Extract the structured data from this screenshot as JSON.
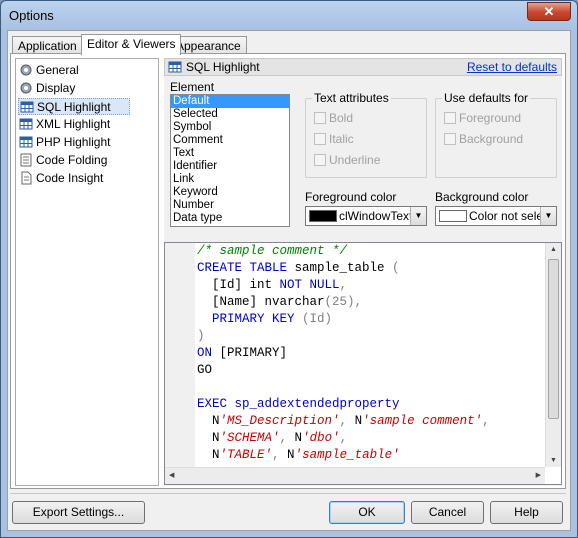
{
  "window": {
    "title": "Options",
    "close_glyph": "✕"
  },
  "tabs": [
    {
      "label": "Application",
      "active": false
    },
    {
      "label": "Editor & Viewers",
      "active": true
    },
    {
      "label": "Appearance",
      "active": false
    }
  ],
  "sidebar": {
    "items": [
      {
        "label": "General",
        "icon": "gear-icon"
      },
      {
        "label": "Display",
        "icon": "display-icon"
      },
      {
        "label": "SQL Highlight",
        "icon": "grid-icon",
        "selected": true
      },
      {
        "label": "XML Highlight",
        "icon": "grid-icon"
      },
      {
        "label": "PHP Highlight",
        "icon": "grid-icon"
      },
      {
        "label": "Code Folding",
        "icon": "folding-icon"
      },
      {
        "label": "Code Insight",
        "icon": "document-icon"
      }
    ]
  },
  "header": {
    "title": "SQL Highlight",
    "reset_label": "Reset to defaults"
  },
  "element": {
    "label": "Element",
    "items": [
      "Default",
      "Selected",
      "Symbol",
      "Comment",
      "Text",
      "Identifier",
      "Link",
      "Keyword",
      "Number",
      "Data type"
    ],
    "selected_index": 0
  },
  "text_attributes": {
    "title": "Text attributes",
    "bold": "Bold",
    "italic": "Italic",
    "underline": "Underline"
  },
  "use_defaults": {
    "title": "Use defaults for",
    "foreground": "Foreground",
    "background": "Background"
  },
  "foreground": {
    "label": "Foreground color",
    "value": "clWindowText",
    "swatch": "#000000"
  },
  "background": {
    "label": "Background color",
    "value": "Color not selected",
    "swatch": "#ffffff"
  },
  "code_lines": [
    [
      [
        "cm",
        "/* sample comment */"
      ]
    ],
    [
      [
        "kw",
        "CREATE TABLE"
      ],
      [
        "id",
        " sample_table "
      ],
      [
        "gr",
        "("
      ]
    ],
    [
      [
        "id",
        "  [Id] int "
      ],
      [
        "kw",
        "NOT NULL"
      ],
      [
        "gr",
        ","
      ]
    ],
    [
      [
        "id",
        "  [Name] nvarchar"
      ],
      [
        "gr",
        "(25),"
      ]
    ],
    [
      [
        "kw",
        "  PRIMARY KEY "
      ],
      [
        "gr",
        "(Id)"
      ]
    ],
    [
      [
        "gr",
        ")"
      ]
    ],
    [
      [
        "kw",
        "ON "
      ],
      [
        "id",
        "[PRIMARY]"
      ]
    ],
    [
      [
        "id",
        "GO"
      ]
    ],
    [
      [
        "id",
        ""
      ]
    ],
    [
      [
        "kw",
        "EXEC sp_addextendedproperty"
      ]
    ],
    [
      [
        "id",
        "  N"
      ],
      [
        "st",
        "'MS_Description'"
      ],
      [
        "gr",
        ", "
      ],
      [
        "id",
        "N"
      ],
      [
        "st",
        "'sample comment'"
      ],
      [
        "gr",
        ","
      ]
    ],
    [
      [
        "id",
        "  N"
      ],
      [
        "st",
        "'SCHEMA'"
      ],
      [
        "gr",
        ", "
      ],
      [
        "id",
        "N"
      ],
      [
        "st",
        "'dbo'"
      ],
      [
        "gr",
        ","
      ]
    ],
    [
      [
        "id",
        "  N"
      ],
      [
        "st",
        "'TABLE'"
      ],
      [
        "gr",
        ", "
      ],
      [
        "id",
        "N"
      ],
      [
        "st",
        "'sample_table'"
      ]
    ]
  ],
  "buttons": {
    "export": "Export Settings...",
    "ok": "OK",
    "cancel": "Cancel",
    "help": "Help"
  }
}
